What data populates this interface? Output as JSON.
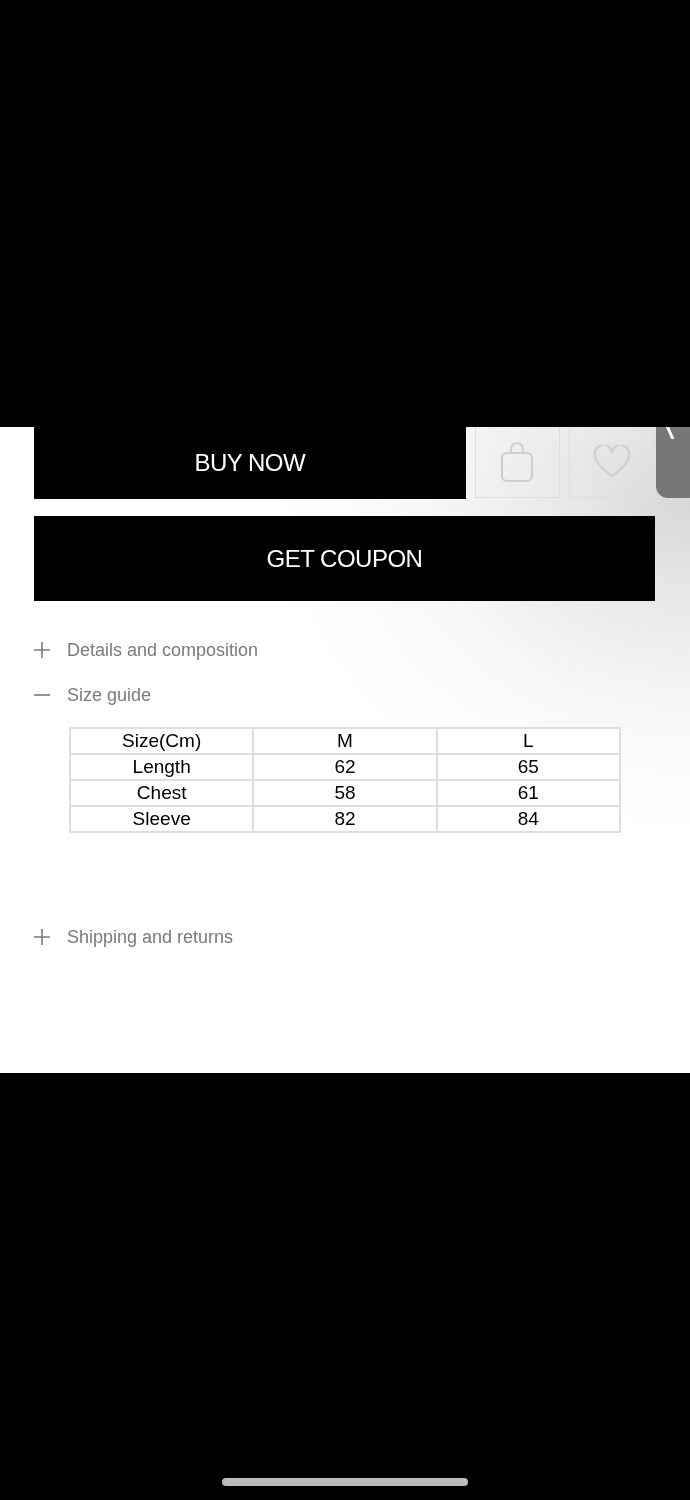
{
  "actions": {
    "buy_now": "BUY NOW",
    "get_coupon": "GET COUPON"
  },
  "accordion": [
    {
      "title": "Details and composition",
      "expanded": false
    },
    {
      "title": "Size guide",
      "expanded": true,
      "table": {
        "columns": [
          "Size(Cm)",
          "M",
          "L"
        ],
        "rows": [
          [
            "Length",
            "62",
            "65"
          ],
          [
            "Chest",
            "58",
            "61"
          ],
          [
            "Sleeve",
            "82",
            "84"
          ]
        ]
      }
    },
    {
      "title": "Shipping and returns",
      "expanded": false
    }
  ]
}
